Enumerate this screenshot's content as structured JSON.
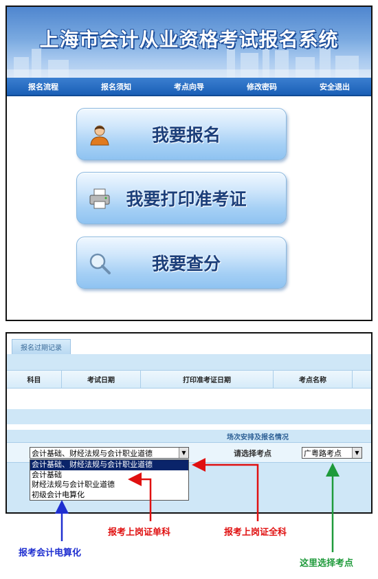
{
  "header": {
    "title": "上海市会计从业资格考试报名系统"
  },
  "nav": {
    "items": [
      "报名流程",
      "报名须知",
      "考点向导",
      "修改密码",
      "安全退出"
    ]
  },
  "actions": {
    "register": "我要报名",
    "print_admission": "我要打印准考证",
    "check_score": "我要查分"
  },
  "records": {
    "tab_label": "报名过期记录",
    "columns": [
      "科目",
      "考试日期",
      "打印准考证日期",
      "考点名称"
    ]
  },
  "arrangement": {
    "section_title": "场次安排及报名情况",
    "subject_selected": "会计基础、财经法规与会计职业道德",
    "subject_options": [
      "会计基础、财经法规与会计职业道德",
      "会计基础",
      "财经法规与会计职业道德",
      "初级会计电算化"
    ],
    "location_label": "请选择考点",
    "location_selected": "广粤路考点"
  },
  "annotations": {
    "full_subjects": "报考上岗证全科",
    "single_subject": "报考上岗证单科",
    "computer_accounting": "报考会计电算化",
    "choose_location": "这里选择考点"
  },
  "colors": {
    "nav_blue": "#1a5fb6",
    "annotation_red": "#e01010",
    "annotation_blue": "#1f2fd0",
    "annotation_green": "#1e9a3a",
    "selected_option_bg": "#0a246a"
  },
  "icons": {
    "register": "person-icon",
    "print_admission": "printer-icon",
    "check_score": "magnifier-icon"
  }
}
